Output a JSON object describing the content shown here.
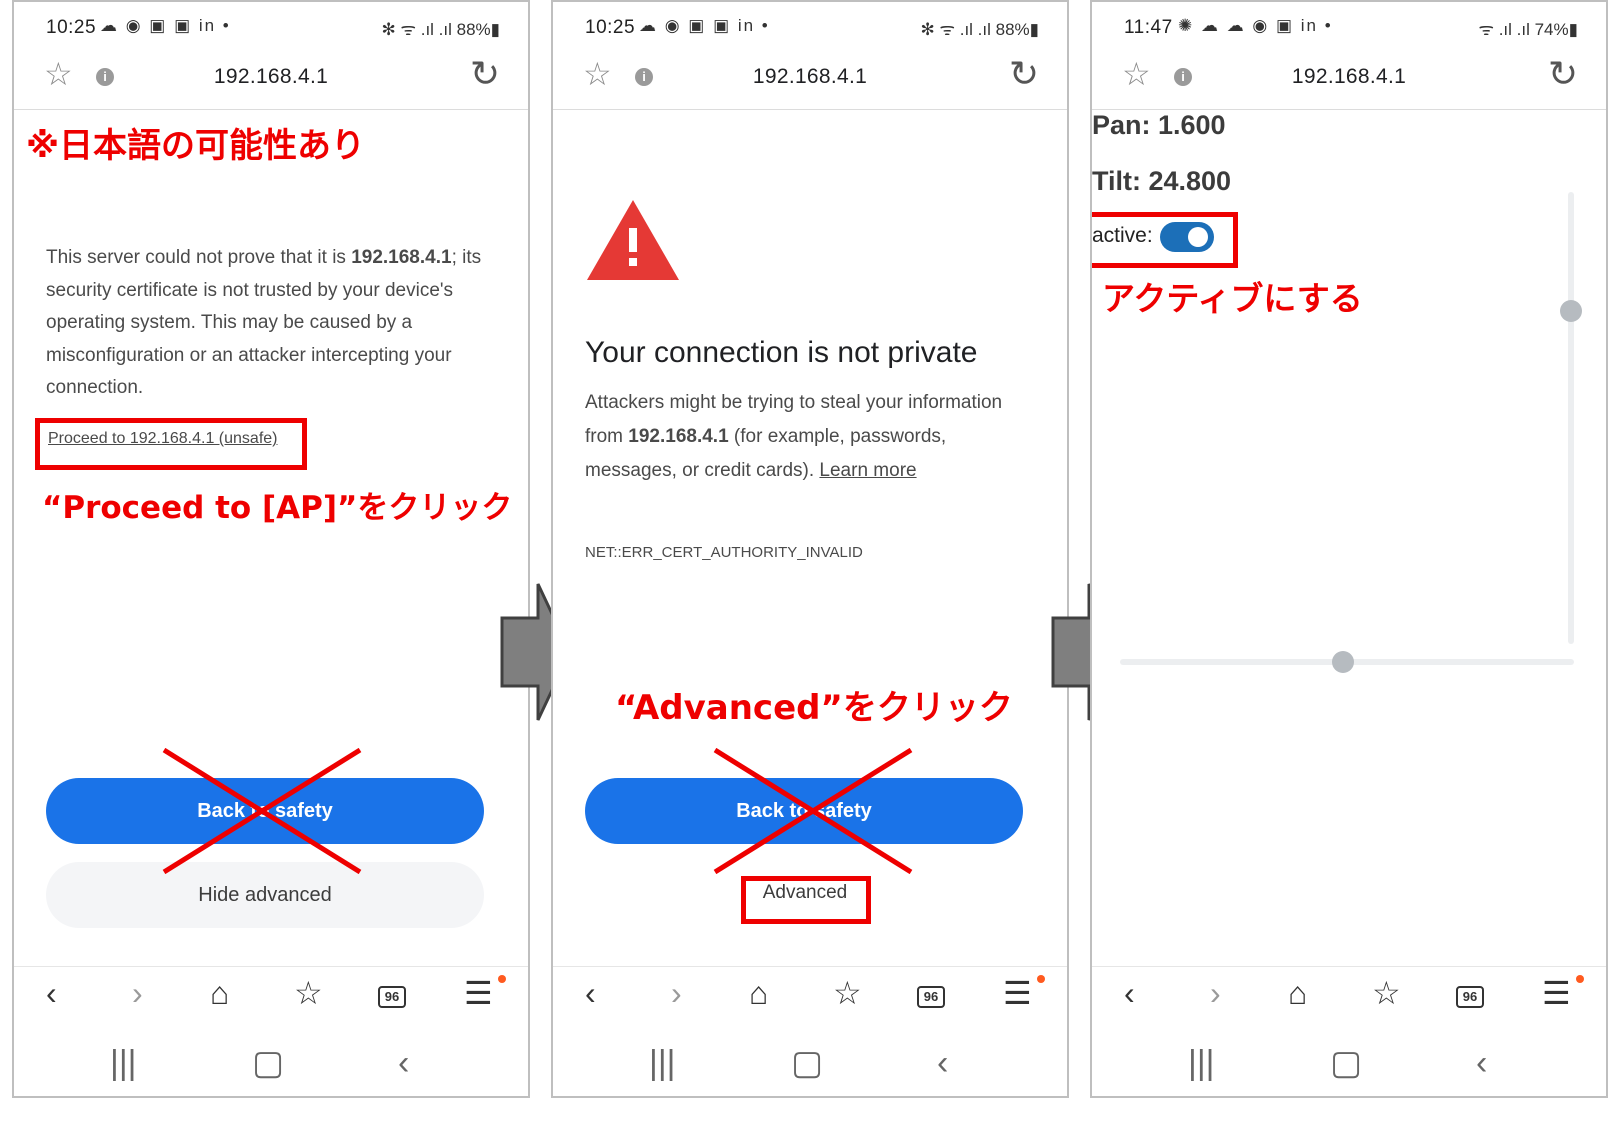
{
  "screens": [
    {
      "status": {
        "time": "10:25",
        "notif": "☁ ◉ ▣ ▣ in •",
        "right": "✻ ᯤ .ıl .ıl 88%▮"
      },
      "url": "192.168.4.1",
      "warning_pre": "This server could not prove that it is ",
      "warning_host": "192.168.4.1",
      "warning_post": "; its security certificate is not trusted by your device's operating system. This may be caused by a misconfiguration or an attacker intercepting your connection.",
      "proceed_link": "Proceed to 192.168.4.1 (unsafe)",
      "primary_button": "Back to safety",
      "secondary_button": "Hide advanced",
      "annotation_top": "※日本語の可能性あり",
      "annotation_click": "“Proceed to [AP]”をクリック"
    },
    {
      "status": {
        "time": "10:25",
        "notif": "☁ ◉ ▣ ▣ in •",
        "right": "✻ ᯤ .ıl .ıl 88%▮"
      },
      "url": "192.168.4.1",
      "heading": "Your connection is not private",
      "desc_pre": "Attackers might be trying to steal your information from ",
      "desc_host": "192.168.4.1",
      "desc_post": " (for example, passwords, messages, or credit cards). ",
      "learn_more": "Learn more",
      "error_code": "NET::ERR_CERT_AUTHORITY_INVALID",
      "primary_button": "Back to safety",
      "advanced_button": "Advanced",
      "annotation_click": "“Advanced”をクリック"
    },
    {
      "status": {
        "time": "11:47",
        "notif": "✺ ☁ ☁ ◉ ▣ in •",
        "right": "ᯤ .ıl .ıl 74%▮"
      },
      "url": "192.168.4.1",
      "pan_label": "Pan: 1.600",
      "tilt_label": "Tilt: 24.800",
      "active_label": "active:",
      "annotation_active": "アクティブにする"
    }
  ],
  "nav": {
    "back": "‹",
    "forward": "›",
    "home": "⌂",
    "bookmarks": "☆",
    "tabs_count": "96",
    "menu": "☰"
  },
  "sys": {
    "recents": "|||",
    "home": "▢",
    "back": "‹"
  },
  "colors": {
    "annotation": "#ee0000",
    "primary_button": "#1a73e8",
    "arrow": "#7f7f7f",
    "warning_triangle": "#e53935",
    "toggle": "#1c6fb8"
  }
}
